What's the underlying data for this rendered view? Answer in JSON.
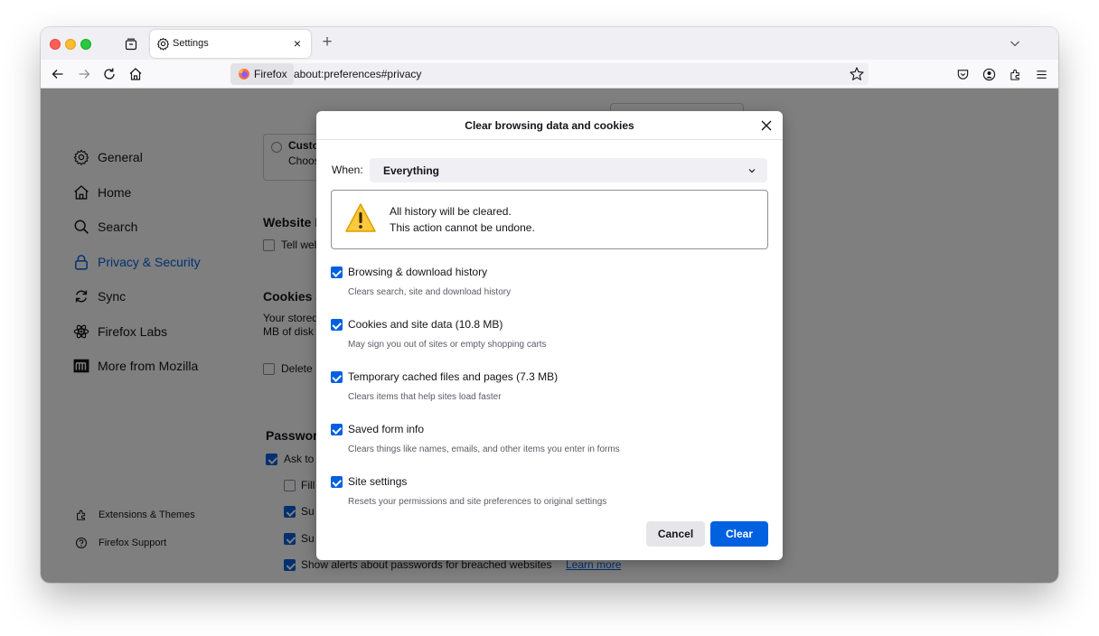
{
  "tab": {
    "title": "Settings",
    "close": "×",
    "new_tab": "+"
  },
  "urlbar": {
    "identity_label": "Firefox",
    "url": "about:preferences#privacy"
  },
  "sidebar": {
    "items": [
      {
        "label": "General",
        "icon": "gear-icon"
      },
      {
        "label": "Home",
        "icon": "home-icon"
      },
      {
        "label": "Search",
        "icon": "search-icon"
      },
      {
        "label": "Privacy & Security",
        "icon": "lock-icon",
        "active": true
      },
      {
        "label": "Sync",
        "icon": "sync-icon"
      },
      {
        "label": "Firefox Labs",
        "icon": "labs-icon"
      },
      {
        "label": "More from Mozilla",
        "icon": "mozilla-icon"
      }
    ],
    "footer": [
      {
        "label": "Extensions & Themes",
        "icon": "extension-icon"
      },
      {
        "label": "Firefox Support",
        "icon": "help-icon"
      }
    ]
  },
  "background": {
    "custom_label": "Custo",
    "custom_desc": "Choos",
    "website_heading": "Website I",
    "tell_web": "Tell wel",
    "cookies_heading": "Cookies a",
    "cookies_text1": "Your stored",
    "cookies_text2": "MB of disk",
    "delete_label": "Delete",
    "passwords_heading": "Passwor",
    "ask_label": "Ask to",
    "fill_label": "Fill",
    "sug1_label": "Su",
    "sug2_label": "Su",
    "breach_label": "Show alerts about passwords for breached websites",
    "learn_more": "Learn more"
  },
  "dialog": {
    "title": "Clear browsing data and cookies",
    "when_label": "When:",
    "when_value": "Everything",
    "warning_line1": "All history will be cleared.",
    "warning_line2": "This action cannot be undone.",
    "options": [
      {
        "label": "Browsing & download history",
        "desc": "Clears search, site and download history",
        "checked": true
      },
      {
        "label": "Cookies and site data (10.8 MB)",
        "desc": "May sign you out of sites or empty shopping carts",
        "checked": true
      },
      {
        "label": "Temporary cached files and pages (7.3 MB)",
        "desc": "Clears items that help sites load faster",
        "checked": true
      },
      {
        "label": "Saved form info",
        "desc": "Clears things like names, emails, and other items you enter in forms",
        "checked": true
      },
      {
        "label": "Site settings",
        "desc": "Resets your permissions and site preferences to original settings",
        "checked": true
      }
    ],
    "cancel_label": "Cancel",
    "clear_label": "Clear"
  },
  "colors": {
    "accent": "#0061e0",
    "overlay": "rgba(0,0,0,0.5)"
  }
}
